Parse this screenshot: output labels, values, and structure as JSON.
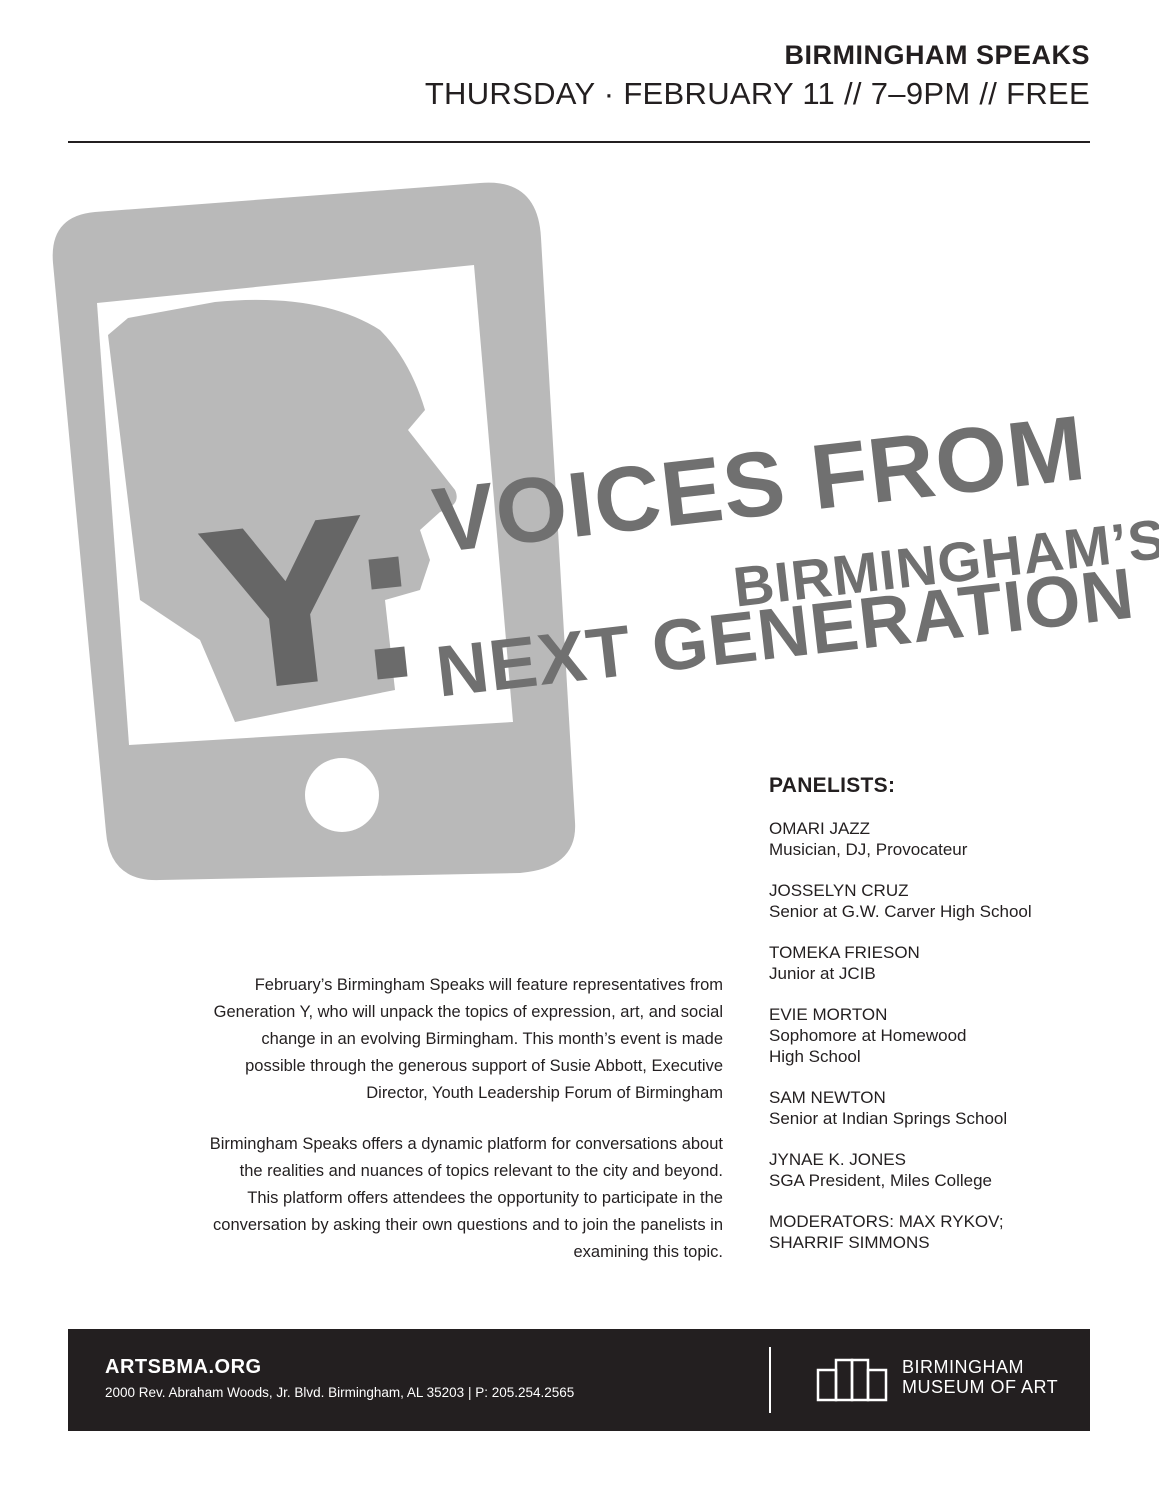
{
  "header": {
    "title": "BIRMINGHAM SPEAKS",
    "subtitle": "THURSDAY · FEBRUARY 11 // 7–9PM // FREE"
  },
  "headline": {
    "letter": "Y",
    "line1": "VOICES FROM",
    "line2": "BIRMINGHAM’S",
    "line3": "NEXT GENERATION"
  },
  "panel": {
    "heading": "PANELISTS:",
    "panelists": [
      {
        "name": "OMARI JAZZ",
        "role": "Musician, DJ, Provocateur"
      },
      {
        "name": "JOSSELYN CRUZ",
        "role": "Senior at G.W. Carver High School"
      },
      {
        "name": "TOMEKA FRIESON",
        "role": "Junior at JCIB"
      },
      {
        "name": "EVIE MORTON",
        "role": "Sophomore at Homewood High School"
      },
      {
        "name": "SAM NEWTON",
        "role": "Senior at Indian Springs School"
      },
      {
        "name": "JYNAE K. JONES",
        "role": "SGA President, Miles College"
      }
    ],
    "moderators": "MODERATORS: MAX RYKOV; SHARRIF SIMMONS"
  },
  "body": {
    "p1": "February’s Birmingham Speaks will feature representatives from Generation Y, who will unpack the topics of expression, art, and social change in an evolving Birmingham. This month’s event is made possible through the generous support of Susie Abbott, Executive Director, Youth Leadership Forum of Birmingham",
    "p2": "Birmingham Speaks offers a dynamic platform for conversations about the realities and nuances of topics relevant to the city and beyond. This platform offers attendees the opportunity to participate in the conversation by asking their own questions and to join the panelists in examining this topic."
  },
  "footer": {
    "site": "ARTSBMA.ORG",
    "address": "2000 Rev. Abraham Woods, Jr. Blvd. Birmingham, AL 35203  |  P: 205.254.2565",
    "museum_line1": "BIRMINGHAM",
    "museum_line2": "MUSEUM OF ART"
  },
  "colors": {
    "phone": "#b9b9b9",
    "headline": "#707070",
    "footer_bg": "#231f20"
  }
}
